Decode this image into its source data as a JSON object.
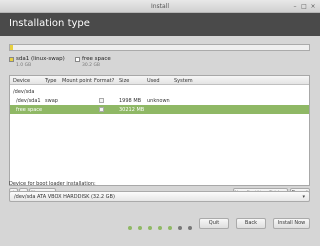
{
  "window": {
    "title": "Install"
  },
  "header": {
    "title": "Installation type"
  },
  "legend": [
    {
      "name": "sda1 (linux-swap)",
      "size": "1.0 GB",
      "color": "#e7d040"
    },
    {
      "name": "free space",
      "size": "30.2 GB",
      "color": "#ffffff"
    }
  ],
  "table": {
    "columns": [
      "Device",
      "Type",
      "Mount point",
      "Format?",
      "Size",
      "Used",
      "System"
    ],
    "rows": [
      {
        "device": "/dev/sda",
        "type": "",
        "mount": "",
        "size": "",
        "used": "",
        "system": ""
      },
      {
        "device": "/dev/sda1",
        "type": "swap",
        "mount": "",
        "size": "1998 MB",
        "used": "unknown",
        "system": ""
      },
      {
        "device": "free space",
        "type": "",
        "mount": "",
        "size": "30212 MB",
        "used": "",
        "system": ""
      }
    ]
  },
  "table_buttons": {
    "add": "+",
    "remove": "−",
    "change": "Change...",
    "new_table": "New Partition Table...",
    "revert": "Revert"
  },
  "boot": {
    "label": "Device for boot loader installation:",
    "value": "/dev/sda ATA VBOX HARDDISK (32.2 GB)"
  },
  "actions": {
    "quit": "Quit",
    "back": "Back",
    "install": "Install Now"
  },
  "colors": {
    "accent": "#8fb865",
    "header_bg": "#4a4a4a",
    "swap": "#e7d040"
  }
}
